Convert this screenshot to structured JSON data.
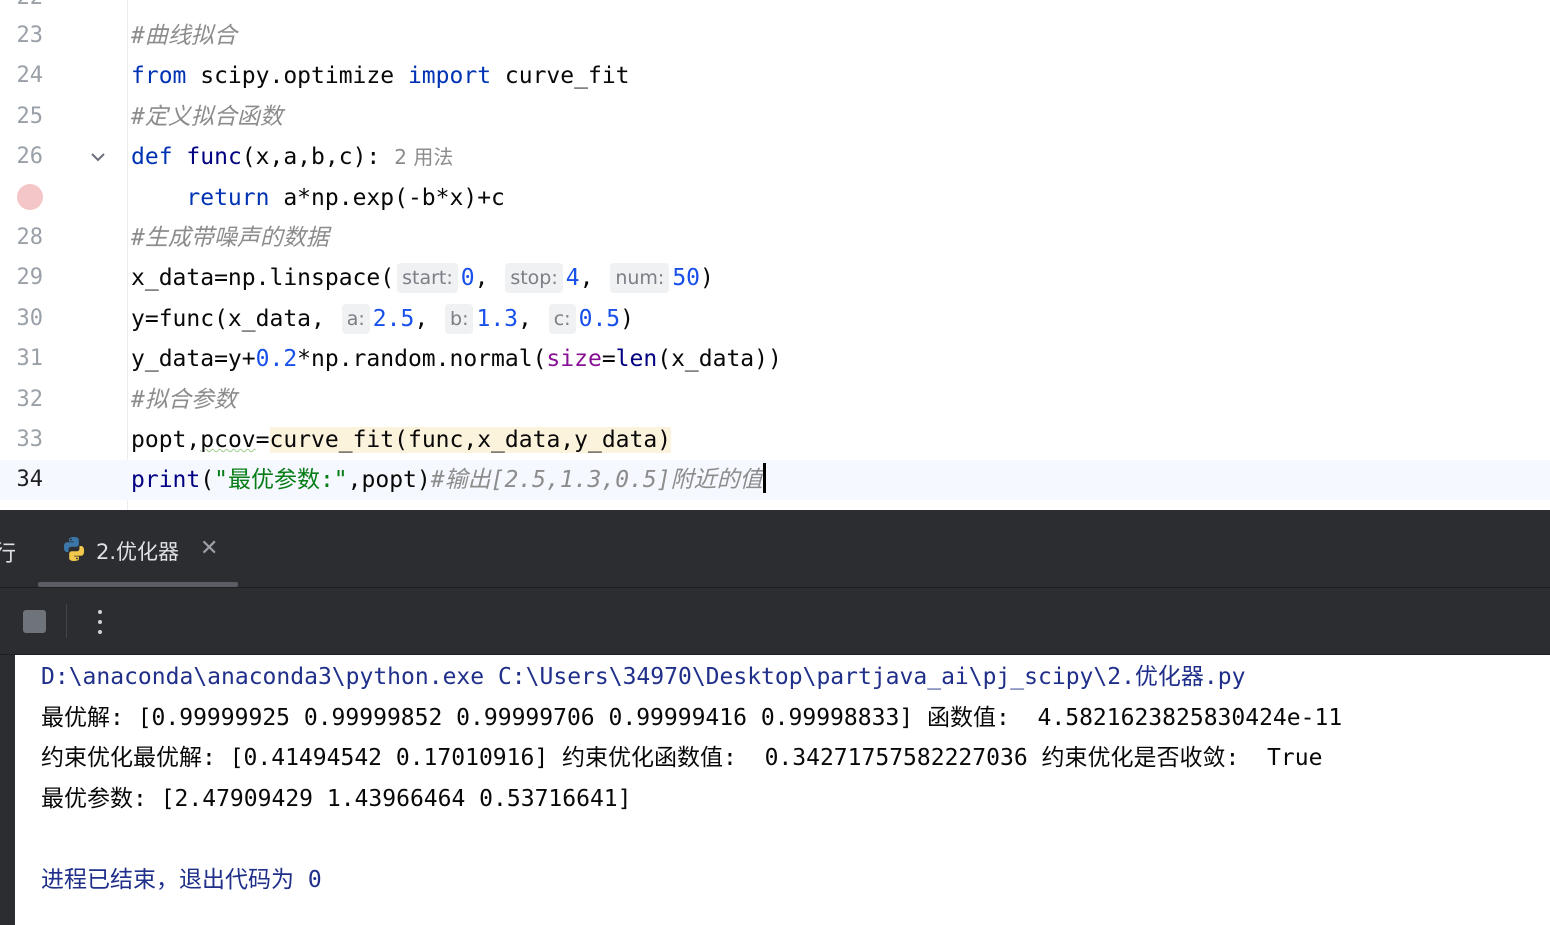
{
  "editor": {
    "partial_top_line_number": "22",
    "lines": [
      {
        "number": "23",
        "tokens": [
          {
            "t": "#曲线拟合",
            "c": "cmt"
          }
        ]
      },
      {
        "number": "24",
        "tokens": [
          {
            "t": "from",
            "c": "kw"
          },
          {
            "t": " scipy.optimize ",
            "c": ""
          },
          {
            "t": "import",
            "c": "kw"
          },
          {
            "t": " curve_fit",
            "c": ""
          }
        ]
      },
      {
        "number": "25",
        "tokens": [
          {
            "t": "#定义拟合函数",
            "c": "cmt"
          }
        ]
      },
      {
        "number": "26",
        "tokens": [
          {
            "t": "def",
            "c": "kw"
          },
          {
            "t": " ",
            "c": ""
          },
          {
            "t": "func",
            "c": "builtin"
          },
          {
            "t": "(x,a,b,c):",
            "c": ""
          },
          {
            "t": "2 用法",
            "c": "usage"
          }
        ]
      },
      {
        "number": "27",
        "tokens": [
          {
            "t": "    ",
            "c": ""
          },
          {
            "t": "return",
            "c": "kw"
          },
          {
            "t": " a*np.exp(-b*x)+c",
            "c": ""
          }
        ]
      },
      {
        "number": "28",
        "tokens": [
          {
            "t": "#生成带噪声的数据",
            "c": "cmt"
          }
        ]
      },
      {
        "number": "29",
        "tokens": [
          {
            "t": "x_data=np.linspace(",
            "c": ""
          },
          {
            "t": "start:",
            "c": "hint"
          },
          {
            "t": "0",
            "c": "num"
          },
          {
            "t": ", ",
            "c": ""
          },
          {
            "t": "stop:",
            "c": "hint"
          },
          {
            "t": "4",
            "c": "num"
          },
          {
            "t": ", ",
            "c": ""
          },
          {
            "t": "num:",
            "c": "hint"
          },
          {
            "t": "50",
            "c": "num"
          },
          {
            "t": ")",
            "c": ""
          }
        ]
      },
      {
        "number": "30",
        "tokens": [
          {
            "t": "y=func(x_data, ",
            "c": ""
          },
          {
            "t": "a:",
            "c": "hint"
          },
          {
            "t": "2.5",
            "c": "num"
          },
          {
            "t": ", ",
            "c": ""
          },
          {
            "t": "b:",
            "c": "hint"
          },
          {
            "t": "1.3",
            "c": "num"
          },
          {
            "t": ", ",
            "c": ""
          },
          {
            "t": "c:",
            "c": "hint"
          },
          {
            "t": "0.5",
            "c": "num"
          },
          {
            "t": ")",
            "c": ""
          }
        ]
      },
      {
        "number": "31",
        "tokens": [
          {
            "t": "y_data=y+",
            "c": ""
          },
          {
            "t": "0.2",
            "c": "num"
          },
          {
            "t": "*np.random.normal(",
            "c": ""
          },
          {
            "t": "size",
            "c": "kwarg"
          },
          {
            "t": "=",
            "c": ""
          },
          {
            "t": "len",
            "c": "builtin"
          },
          {
            "t": "(x_data))",
            "c": ""
          }
        ]
      },
      {
        "number": "32",
        "tokens": [
          {
            "t": "#拟合参数",
            "c": "cmt"
          }
        ]
      },
      {
        "number": "33",
        "tokens": [
          {
            "t": "popt,",
            "c": ""
          },
          {
            "t": "pcov",
            "c": "underline-wavy"
          },
          {
            "t": "=",
            "c": ""
          },
          {
            "t": "curve_fit(func,x_data,y_data)",
            "c": "hl"
          }
        ]
      },
      {
        "number": "34",
        "tokens": [
          {
            "t": "print",
            "c": "builtin"
          },
          {
            "t": "(",
            "c": ""
          },
          {
            "t": "\"最优参数:\"",
            "c": "str"
          },
          {
            "t": ",popt)",
            "c": ""
          },
          {
            "t": "#输出[2.5,1.3,0.5]附近的值",
            "c": "cmt"
          }
        ]
      }
    ]
  },
  "run_panel": {
    "edge_label": "行",
    "tab": {
      "label": "2.优化器",
      "icon": "python-icon",
      "close": "✕"
    },
    "toolbar": {
      "stop_icon": "stop-icon",
      "more_icon": "more-vertical-icon"
    },
    "console_lines": [
      {
        "text": "D:\\anaconda\\anaconda3\\python.exe C:\\Users\\34970\\Desktop\\partjava_ai\\pj_scipy\\2.优化器.py",
        "kind": "sys"
      },
      {
        "text": "最优解: [0.99999925 0.99999852 0.99999706 0.99999416 0.99998833] 函数值:  4.5821623825830424e-11",
        "kind": "out"
      },
      {
        "text": "约束优化最优解: [0.41494542 0.17010916] 约束优化函数值:  0.34271757582227036 约束优化是否收敛:  True",
        "kind": "out"
      },
      {
        "text": "最优参数: [2.47909429 1.43966464 0.53716641]",
        "kind": "out"
      },
      {
        "text": "",
        "kind": "out"
      },
      {
        "text": "进程已结束，退出代码为 0",
        "kind": "sys"
      }
    ]
  },
  "colors": {
    "keyword": "#0033b3",
    "number": "#1750eb",
    "string": "#067d17",
    "comment": "#8c8c8c",
    "panel_bg": "#2b2d30",
    "breakpoint": "#f5c6c7"
  }
}
